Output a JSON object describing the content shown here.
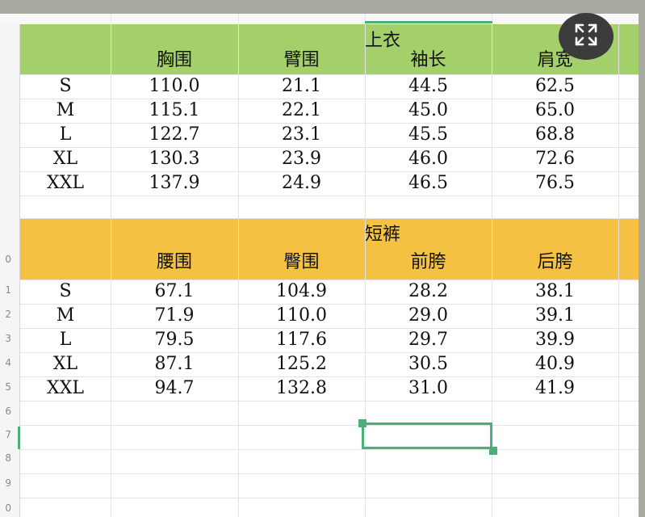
{
  "sections": [
    {
      "title": "上衣",
      "headers": [
        "胸围",
        "臂围",
        "袖长",
        "肩宽"
      ],
      "rows": [
        [
          "S",
          "110.0",
          "21.1",
          "44.5",
          "62.5"
        ],
        [
          "M",
          "115.1",
          "22.1",
          "45.0",
          "65.0"
        ],
        [
          "L",
          "122.7",
          "23.1",
          "45.5",
          "68.8"
        ],
        [
          "XL",
          "130.3",
          "23.9",
          "46.0",
          "72.6"
        ],
        [
          "XXL",
          "137.9",
          "24.9",
          "46.5",
          "76.5"
        ]
      ]
    },
    {
      "title": "短裤",
      "headers": [
        "腰围",
        "臀围",
        "前胯",
        "后胯"
      ],
      "rows": [
        [
          "S",
          "67.1",
          "104.9",
          "28.2",
          "38.1"
        ],
        [
          "M",
          "71.9",
          "110.0",
          "29.0",
          "39.1"
        ],
        [
          "L",
          "79.5",
          "117.6",
          "29.7",
          "39.9"
        ],
        [
          "XL",
          "87.1",
          "125.2",
          "30.5",
          "40.9"
        ],
        [
          "XXL",
          "94.7",
          "132.8",
          "31.0",
          "41.9"
        ]
      ]
    }
  ],
  "row_numbers": [
    "0",
    "1",
    "2",
    "3",
    "4",
    "5",
    "6",
    "7",
    "8",
    "9",
    "0"
  ],
  "colors": {
    "green_band": "#a3d06a",
    "orange_band": "#f5c142",
    "selection": "#4caf7a"
  },
  "icons": {
    "expand": "fullscreen-expand-icon"
  }
}
